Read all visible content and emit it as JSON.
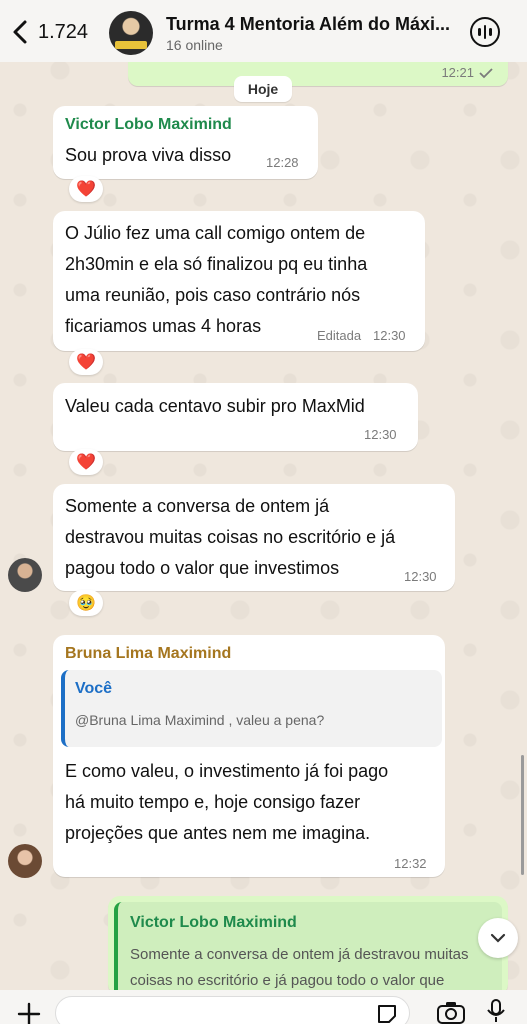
{
  "header": {
    "back_count": "1.724",
    "title": "Turma 4 Mentoria Além do Máxi...",
    "subtitle": "16 online"
  },
  "top_out": {
    "time": "12:21"
  },
  "date_label": "Hoje",
  "messages": [
    {
      "sender": "Victor Lobo Maximind",
      "text": "Sou prova viva disso",
      "time": "12:28",
      "reaction": "❤️"
    },
    {
      "lines": [
        "O Júlio fez uma call comigo ontem de",
        "2h30min e ela só finalizou pq eu tinha",
        "uma reunião, pois caso contrário nós",
        "ficariamos umas 4 horas"
      ],
      "edited": "Editada",
      "time": "12:30",
      "reaction": "❤️"
    },
    {
      "text": "Valeu cada centavo subir pro MaxMid",
      "time": "12:30",
      "reaction": "❤️"
    },
    {
      "lines": [
        "Somente a conversa de ontem já",
        "destravou muitas coisas no escritório e já",
        "pagou todo o valor que investimos"
      ],
      "time": "12:30",
      "reaction": "🥹"
    },
    {
      "sender": "Bruna Lima Maximind",
      "reply": {
        "author": "Você",
        "text": "@Bruna Lima Maximind , valeu a pena?"
      },
      "lines": [
        "E como valeu, o investimento já foi pago",
        "há muito tempo e, hoje consigo fazer",
        "projeções que antes nem me imagina."
      ],
      "time": "12:32"
    }
  ],
  "out_reply": {
    "author": "Victor Lobo Maximind",
    "lines": [
      "Somente a conversa de ontem já destravou muitas",
      "coisas no escritório e já pagou todo o valor que"
    ]
  },
  "colors": {
    "victor": "#1f8a4c",
    "bruna": "#a5761f",
    "you": "#1d6fc6"
  }
}
